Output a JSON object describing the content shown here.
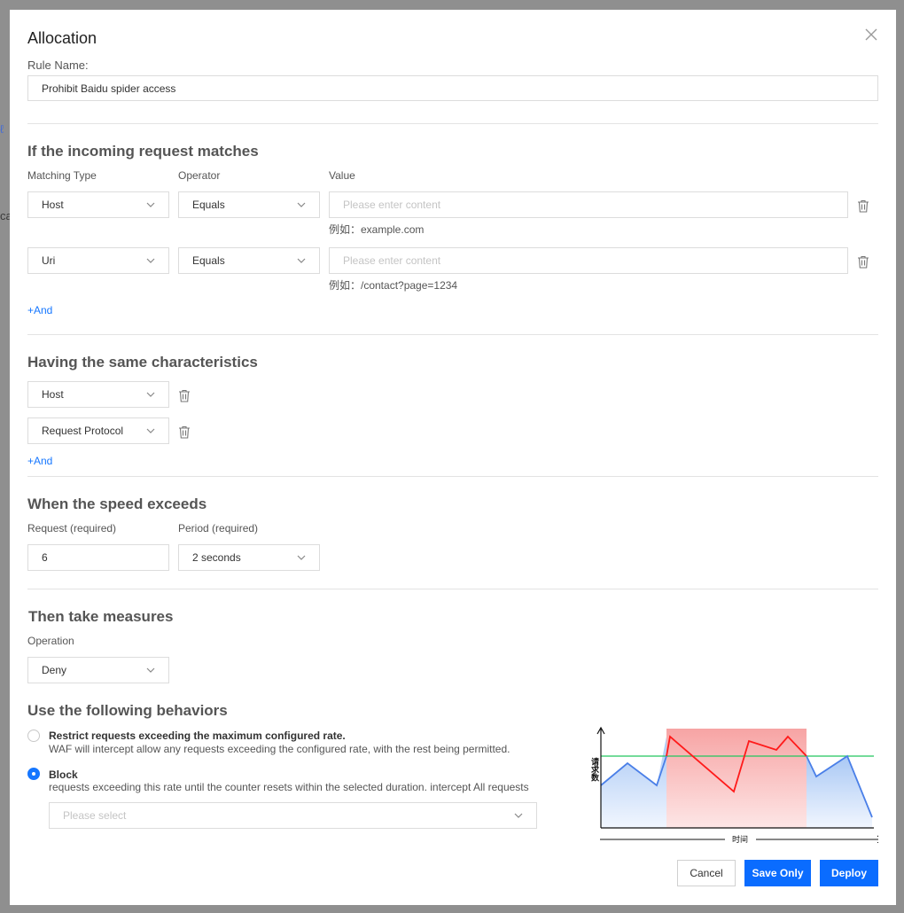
{
  "dialog": {
    "title": "Allocation",
    "rule_name_label": "Rule Name:",
    "rule_name_value": "Prohibit Baidu spider access"
  },
  "match_section": {
    "title": "If the incoming request matches",
    "col_matching_type": "Matching Type",
    "col_operator": "Operator",
    "col_value": "Value",
    "rows": [
      {
        "type": "Host",
        "operator": "Equals",
        "value_placeholder": "Please enter content",
        "hint": "例如：example.com"
      },
      {
        "type": "Uri",
        "operator": "Equals",
        "value_placeholder": "Please enter content",
        "hint": "例如：/contact?page=1234"
      }
    ],
    "add_label": "+And"
  },
  "characteristics_section": {
    "title": "Having the same characteristics",
    "rows": [
      {
        "value": "Host"
      },
      {
        "value": "Request Protocol"
      }
    ],
    "add_label": "+And"
  },
  "speed_section": {
    "title": "When the speed exceeds",
    "request_label": "Request (required)",
    "period_label": "Period (required)",
    "request_value": "6",
    "period_value": "2 seconds"
  },
  "measures_section": {
    "title": "Then take measures",
    "operation_label": "Operation",
    "operation_value": "Deny"
  },
  "behaviors_section": {
    "title": "Use the following behaviors",
    "options": [
      {
        "title": "Restrict requests exceeding the maximum configured rate.",
        "desc": "WAF will intercept allow any requests exceeding the configured rate, with the rest being permitted.",
        "selected": false
      },
      {
        "title": "Block",
        "desc": "requests exceeding this rate until the counter resets within the selected duration. intercept All requests",
        "selected": true
      }
    ],
    "select_placeholder": "Please select",
    "diagram_y_label": "请求数",
    "diagram_x_label": "时间"
  },
  "footer": {
    "cancel_label": "Cancel",
    "save_only_label": "Save Only",
    "deploy_label": "Deploy"
  },
  "background": {
    "fragment_top": "ℓ",
    "fragment_mid": "ca"
  },
  "colors": {
    "primary": "#0a6cff",
    "link": "#1677ff",
    "threshold_line": "#22c55e",
    "exceed_region": "#f8a8a8",
    "exceed_line": "#ff1a1a",
    "normal_line": "#4a7fe8"
  },
  "icons": [
    "close-icon",
    "chevron-down-icon",
    "trash-icon"
  ]
}
